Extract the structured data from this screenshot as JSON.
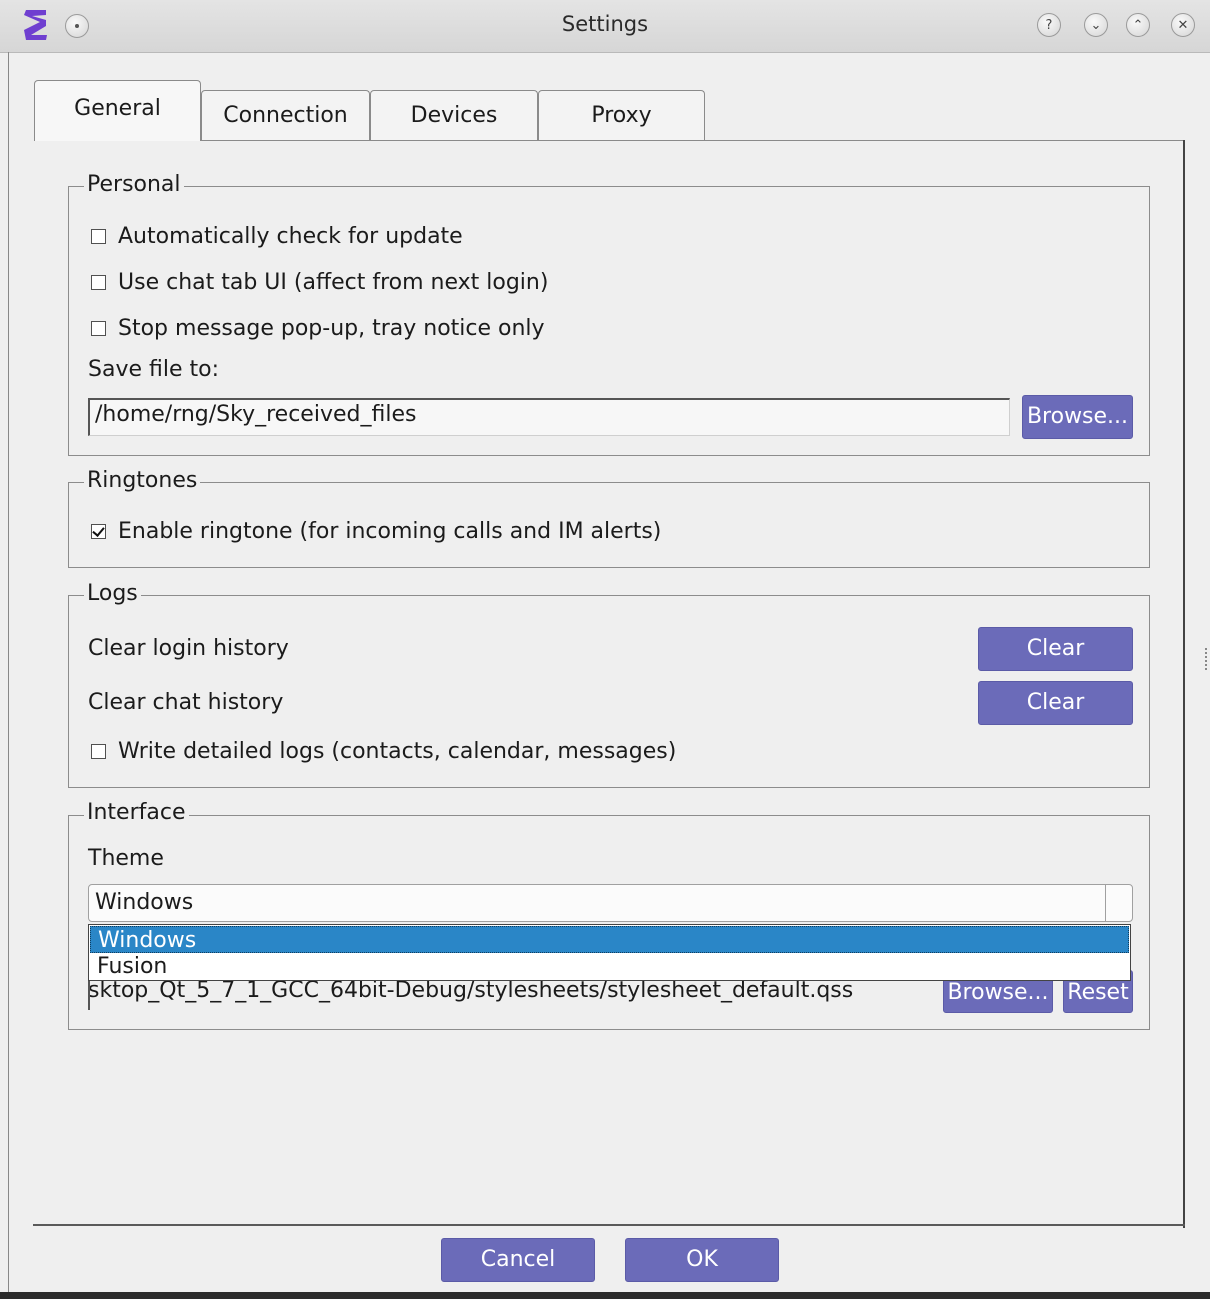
{
  "window": {
    "title": "Settings"
  },
  "title_buttons": {
    "help": "?",
    "minimize": "⌄",
    "maximize": "⌃",
    "close": "✕"
  },
  "tabs": [
    {
      "label": "General",
      "active": true
    },
    {
      "label": "Connection",
      "active": false
    },
    {
      "label": "Devices",
      "active": false
    },
    {
      "label": "Proxy",
      "active": false
    }
  ],
  "personal": {
    "title": "Personal",
    "auto_update": {
      "label": "Automatically check for update",
      "checked": false
    },
    "chat_tab": {
      "label": "Use chat tab UI (affect from next login)",
      "checked": false
    },
    "stop_popup": {
      "label": "Stop message pop-up, tray notice only",
      "checked": false
    },
    "save_label": "Save file to:",
    "save_path": "/home/rng/Sky_received_files",
    "browse": "Browse..."
  },
  "ringtones": {
    "title": "Ringtones",
    "enable": {
      "label": "Enable ringtone (for incoming calls and IM alerts)",
      "checked": true
    }
  },
  "logs": {
    "title": "Logs",
    "login_label": "Clear login history",
    "login_button": "Clear",
    "chat_label": "Clear chat history",
    "chat_button": "Clear",
    "detailed": {
      "label": "Write detailed logs (contacts, calendar, messages)",
      "checked": false
    }
  },
  "interface": {
    "title": "Interface",
    "theme_label": "Theme",
    "theme_value": "Windows",
    "theme_options": [
      "Windows",
      "Fusion"
    ],
    "theme_selected_option": "Windows",
    "stylesheet_path": "sktop_Qt_5_7_1_GCC_64bit-Debug/stylesheets/stylesheet_default.qss",
    "browse": "Browse...",
    "reset": "Reset"
  },
  "footer": {
    "cancel": "Cancel",
    "ok": "OK"
  },
  "colors": {
    "button": "#6b6bb9",
    "selection": "#2a86c7",
    "app_icon": "#6f3fd0"
  }
}
